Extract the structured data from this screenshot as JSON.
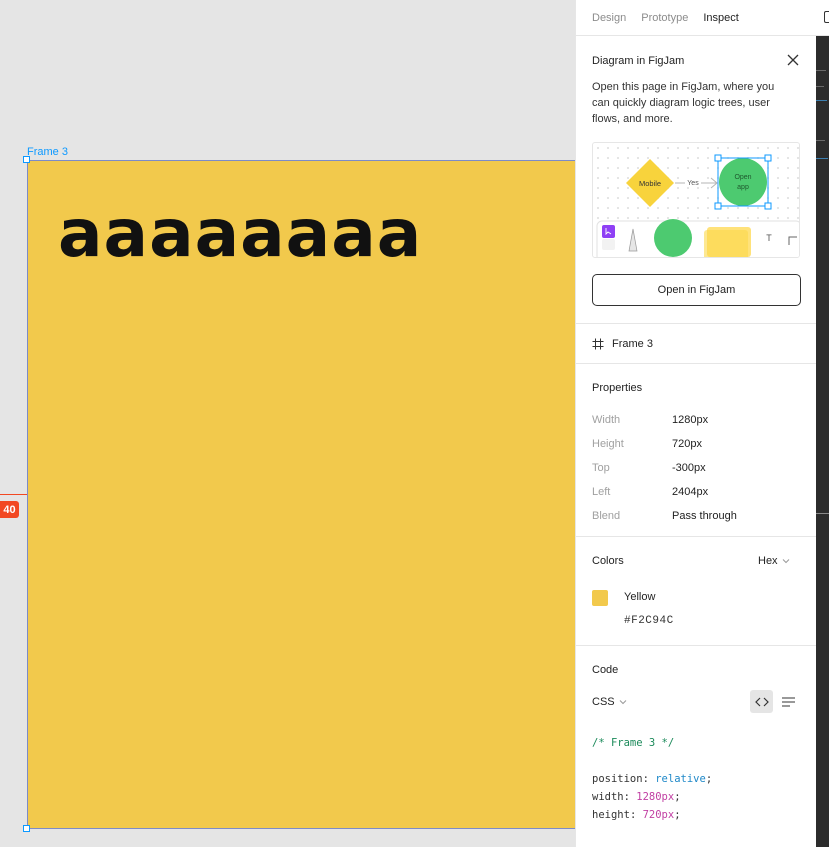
{
  "canvas": {
    "frame_label": "Frame 3",
    "frame_text": "aaaaaaaa",
    "frame_color": "#F2C94C",
    "measure_badge": "40"
  },
  "tabs": [
    {
      "label": "Design",
      "active": false
    },
    {
      "label": "Prototype",
      "active": false
    },
    {
      "label": "Inspect",
      "active": true
    }
  ],
  "figjam": {
    "title": "Diagram in FigJam",
    "description": "Open this page in FigJam, where you can quickly diagram logic trees, user flows, and more.",
    "illus_mobile": "Mobile",
    "illus_yes": "Yes",
    "illus_open_line1": "Open",
    "illus_open_line2": "app",
    "illus_t": "T",
    "button_label": "Open in FigJam"
  },
  "layer": {
    "icon": "frame-icon",
    "name": "Frame 3"
  },
  "properties": {
    "title": "Properties",
    "rows": [
      {
        "key": "Width",
        "value": "1280px"
      },
      {
        "key": "Height",
        "value": "720px"
      },
      {
        "key": "Top",
        "value": "-300px"
      },
      {
        "key": "Left",
        "value": "2404px"
      },
      {
        "key": "Blend",
        "value": "Pass through"
      }
    ]
  },
  "colors": {
    "title": "Colors",
    "format": "Hex",
    "items": [
      {
        "name": "Yellow",
        "hex": "#F2C94C"
      }
    ]
  },
  "code": {
    "title": "Code",
    "language": "CSS",
    "comment": "/* Frame 3 */",
    "lines": [
      {
        "prop": "position",
        "value": "relative",
        "kind": "kw"
      },
      {
        "prop": "width",
        "value": "1280px",
        "kind": "num"
      },
      {
        "prop": "height",
        "value": "720px",
        "kind": "num"
      }
    ]
  }
}
